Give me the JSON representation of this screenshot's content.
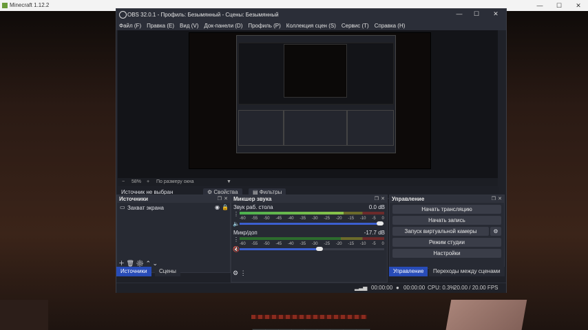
{
  "mc": {
    "title": "Minecraft 1.12.2"
  },
  "obs": {
    "title": "OBS 32.0.1 - Профиль: Безымянный - Сцены: Безымянный",
    "menu": [
      "Файл (F)",
      "Правка (E)",
      "Вид (V)",
      "Док-панели (D)",
      "Профиль (P)",
      "Коллекция сцен (S)",
      "Сервис (T)",
      "Справка (H)"
    ],
    "zoom": {
      "minus": "−",
      "value": "58%",
      "plus": "+",
      "fit": "По размеру окна"
    },
    "context": {
      "no_source": "Источник не выбран",
      "properties": "Свойства",
      "filters": "Фильтры"
    },
    "sources": {
      "header": "Источники",
      "items": [
        {
          "label": "Захват экрана"
        }
      ]
    },
    "mixer": {
      "header": "Микшер звука",
      "scale": [
        "-60",
        "-55",
        "-50",
        "-45",
        "-40",
        "-35",
        "-30",
        "-25",
        "-20",
        "-15",
        "-10",
        "-5",
        "0"
      ],
      "channels": [
        {
          "name": "Звук раб. стола",
          "db": "0.0 dB",
          "level": 0.72
        },
        {
          "name": "Микр/доп",
          "db": "-17.7 dB",
          "level": 0.0
        }
      ]
    },
    "controls": {
      "header": "Управление",
      "buttons": [
        "Начать трансляцию",
        "Начать запись",
        "Запуск виртуальной камеры",
        "Режим студии",
        "Настройки"
      ]
    },
    "tabs_left": [
      "Источники",
      "Сцены"
    ],
    "tabs_right": [
      "Управление",
      "Переходы между сценами"
    ],
    "status": {
      "t1": "00:00:00",
      "t2": "00:00:00",
      "cpu": "CPU: 0.3%",
      "fps": "20.00 / 20.00 FPS"
    }
  }
}
